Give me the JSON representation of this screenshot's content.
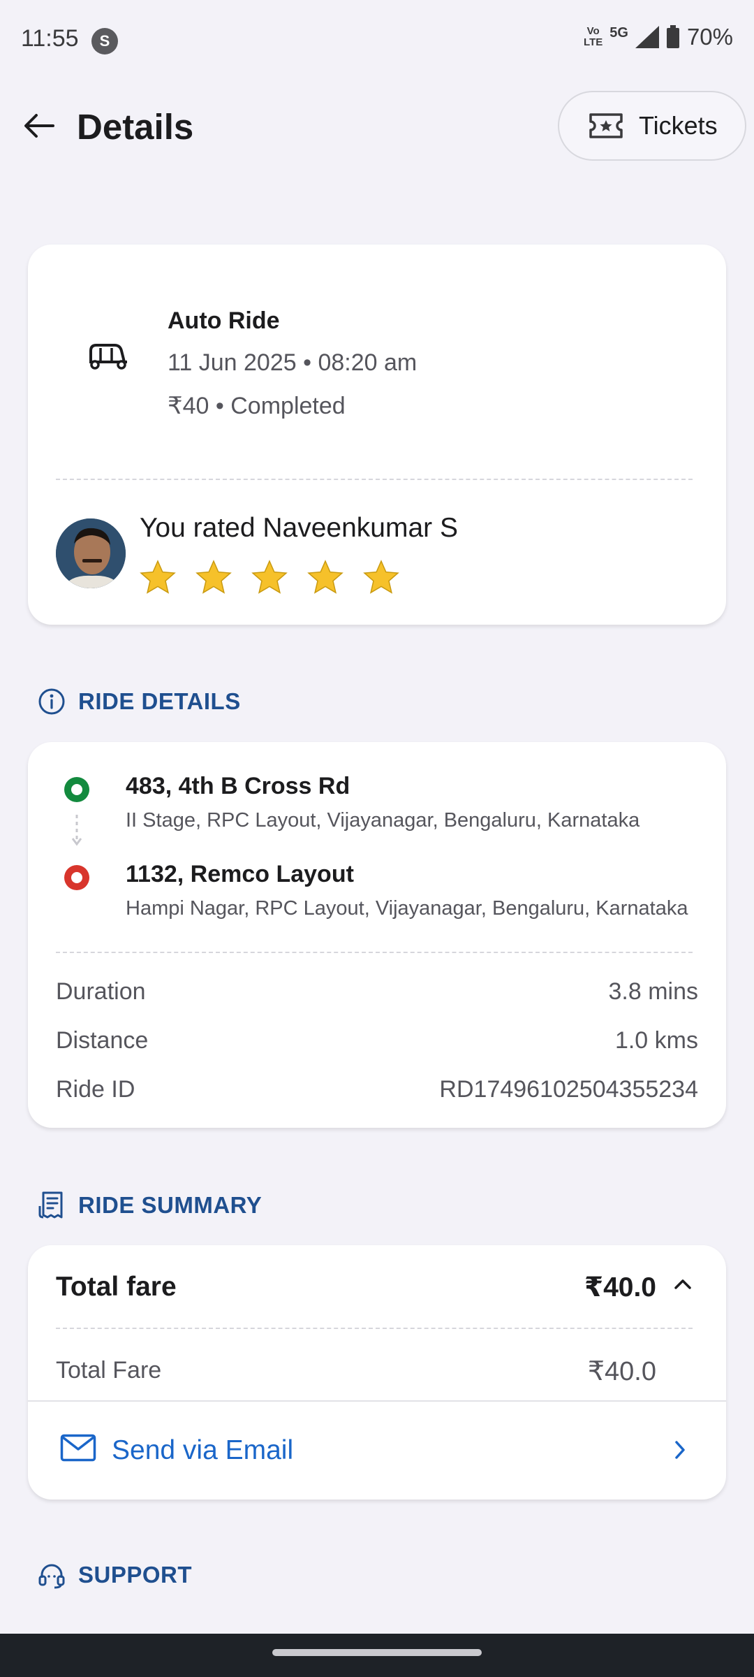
{
  "status_bar": {
    "time": "11:55",
    "app_icon_letter": "S",
    "volte_label": "Vo LTE",
    "network": "5G",
    "battery": "70%"
  },
  "header": {
    "title": "Details",
    "tickets_label": "Tickets"
  },
  "ride": {
    "type": "Auto Ride",
    "datetime": "11 Jun 2025 • 08:20 am",
    "fare_status": "₹40 • Completed",
    "rated_text": "You rated Naveenkumar S",
    "rating": 5,
    "rating_max": 5
  },
  "ride_details": {
    "section_title": "RIDE DETAILS",
    "pickup": {
      "title": "483, 4th B Cross Rd",
      "subtitle": "II Stage, RPC Layout, Vijayanagar, Bengaluru, Karnataka"
    },
    "drop": {
      "title": "1132, Remco Layout",
      "subtitle": "Hampi Nagar, RPC Layout, Vijayanagar, Bengaluru, Karnataka"
    },
    "rows": [
      {
        "label": "Duration",
        "value": "3.8 mins"
      },
      {
        "label": "Distance",
        "value": "1.0 kms"
      },
      {
        "label": "Ride ID",
        "value": "RD17496102504355234"
      }
    ]
  },
  "ride_summary": {
    "section_title": "RIDE SUMMARY",
    "total_fare_label": "Total fare",
    "total_fare_value": "₹40.0",
    "fare_row_label": "Total Fare",
    "fare_row_value": "₹40.0",
    "email_label": "Send via Email"
  },
  "support": {
    "section_title": "SUPPORT"
  },
  "colors": {
    "accent_blue": "#1a66c9",
    "section_blue": "#1f4f8f",
    "pickup_green": "#138a3e",
    "drop_red": "#d8352c",
    "star_yellow": "#f6c12a"
  }
}
